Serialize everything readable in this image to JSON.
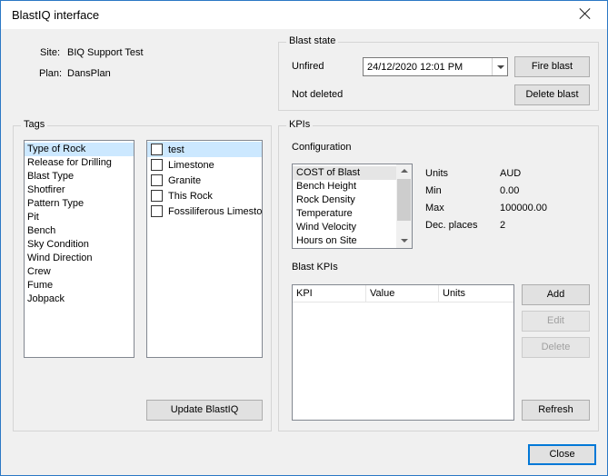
{
  "window": {
    "title": "BlastIQ interface"
  },
  "info": {
    "site_label": "Site:",
    "site_value": "BIQ Support Test",
    "plan_label": "Plan:",
    "plan_value": "DansPlan"
  },
  "blast_state": {
    "title": "Blast state",
    "state": "Unfired",
    "datetime": "24/12/2020 12:01 PM",
    "fire_button": "Fire blast",
    "deleted_state": "Not deleted",
    "delete_button": "Delete blast"
  },
  "tags": {
    "title": "Tags",
    "categories": [
      {
        "label": "Type of Rock",
        "selected": true
      },
      {
        "label": "Release for Drilling"
      },
      {
        "label": "Blast Type"
      },
      {
        "label": "Shotfirer"
      },
      {
        "label": "Pattern Type"
      },
      {
        "label": "Pit"
      },
      {
        "label": "Bench"
      },
      {
        "label": "Sky Condition"
      },
      {
        "label": "Wind Direction"
      },
      {
        "label": "Crew"
      },
      {
        "label": "Fume"
      },
      {
        "label": "Jobpack"
      }
    ],
    "values": [
      {
        "label": "test",
        "checked": false,
        "selected": true
      },
      {
        "label": "Limestone",
        "checked": false
      },
      {
        "label": "Granite",
        "checked": false
      },
      {
        "label": "This Rock",
        "checked": false
      },
      {
        "label": "Fossiliferous Limeston",
        "checked": false
      }
    ],
    "update_button": "Update BlastIQ"
  },
  "kpis": {
    "title": "KPIs",
    "configuration_label": "Configuration",
    "configuration_items": [
      {
        "label": "COST of Blast",
        "selected": true
      },
      {
        "label": "Bench Height"
      },
      {
        "label": "Rock Density"
      },
      {
        "label": "Temperature"
      },
      {
        "label": "Wind Velocity"
      },
      {
        "label": "Hours on Site"
      }
    ],
    "details": {
      "units_label": "Units",
      "units_value": "AUD",
      "min_label": "Min",
      "min_value": "0.00",
      "max_label": "Max",
      "max_value": "100000.00",
      "dec_label": "Dec. places",
      "dec_value": "2"
    },
    "blast_kpis_label": "Blast KPIs",
    "grid_columns": [
      "KPI",
      "Value",
      "Units"
    ],
    "grid_rows": [],
    "add_button": "Add",
    "edit_button": "Edit",
    "delete_button": "Delete",
    "refresh_button": "Refresh"
  },
  "footer": {
    "close_button": "Close"
  }
}
